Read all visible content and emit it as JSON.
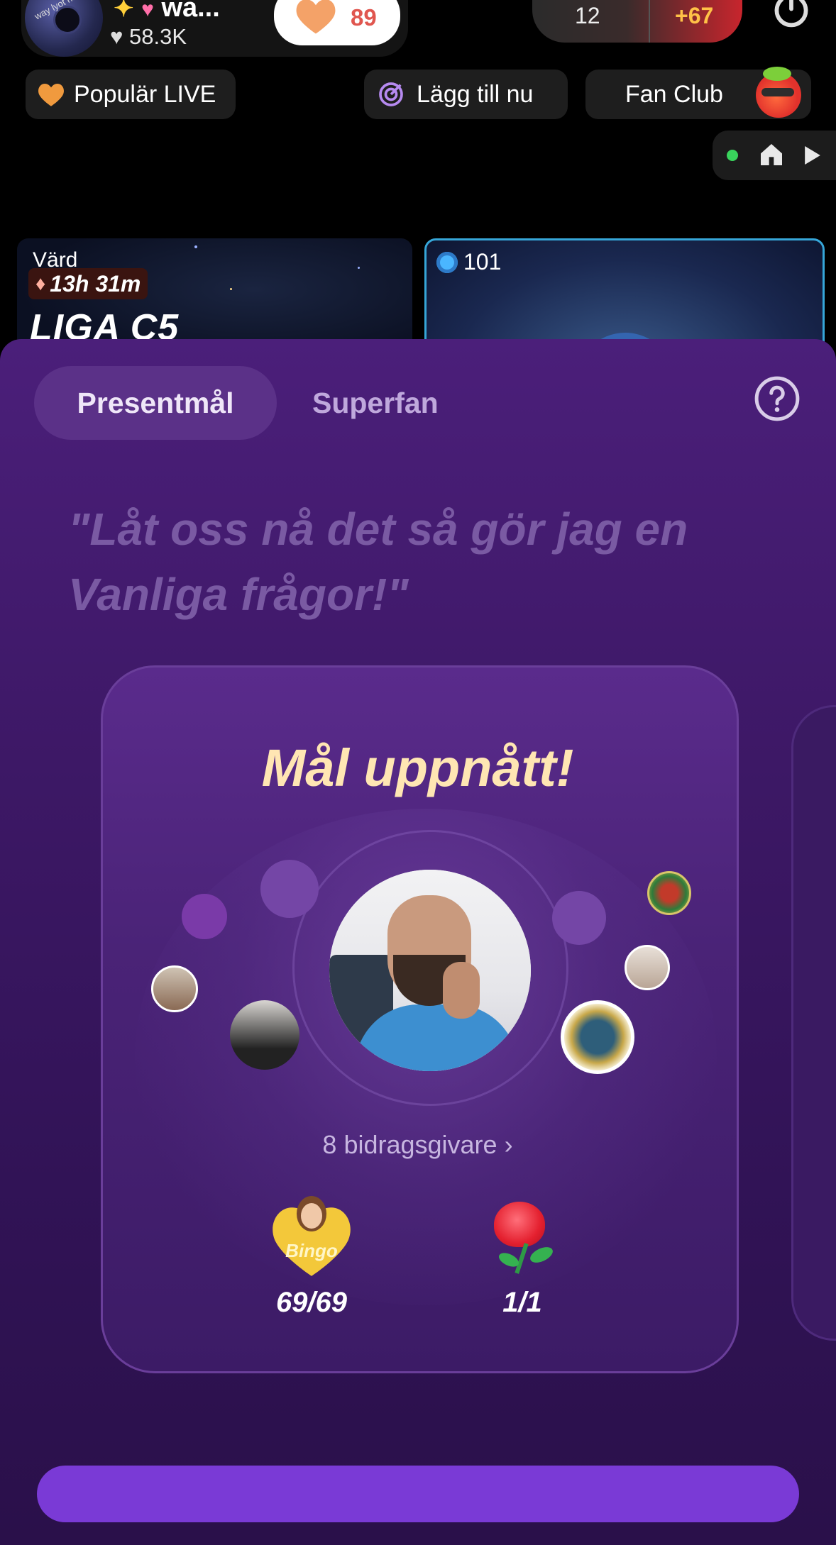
{
  "host": {
    "name": "wa...",
    "likes": "58.3K",
    "like_button_count": "89",
    "avatar_text": "way lyot napk"
  },
  "score": {
    "left": "12",
    "right": "+67"
  },
  "chips": {
    "popular": "Populär LIVE",
    "add_now": "Lägg till nu",
    "fan_club": "Fan Club"
  },
  "preview_cards": {
    "left_host_label": "Värd",
    "left_timer": "13h 31m",
    "left_league": "LIGA C5",
    "right_count": "101"
  },
  "tabs": {
    "active": "Presentmål",
    "second": "Superfan"
  },
  "quote": "\"Låt oss nå det så gör jag en Vanliga frågor!\"",
  "goal": {
    "title": "Mål uppnått!",
    "contributors": "8 bidragsgivare ›",
    "gifts": [
      {
        "name": "Bingo",
        "progress": "69/69"
      },
      {
        "name": "Rose",
        "progress": "1/1"
      }
    ]
  },
  "colors": {
    "sheet": "#3d1866",
    "goal_title": "#ffe6b3",
    "like_count": "#e0564f",
    "score_plus": "#ffc247"
  }
}
